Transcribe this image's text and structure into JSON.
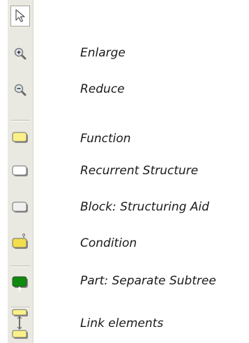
{
  "toolbar": {
    "tools": [
      {
        "icon": "pointer-arrow-icon",
        "label": ""
      },
      {
        "icon": "zoom-in-icon",
        "label": "Enlarge"
      },
      {
        "icon": "zoom-out-icon",
        "label": "Reduce"
      },
      {
        "icon": "function-node-icon",
        "label": "Function",
        "color": "#fbf08a"
      },
      {
        "icon": "recurrent-structure-node-icon",
        "label": "Recurrent Structure",
        "color": "#ffffff"
      },
      {
        "icon": "block-node-icon",
        "label": "Block: Structuring Aid",
        "color": "#f0f0f0"
      },
      {
        "icon": "condition-node-icon",
        "label": "Condition",
        "color": "#f2dd4c"
      },
      {
        "icon": "part-subtree-node-icon",
        "label": "Part: Separate Subtree",
        "color": "#0f8a0f"
      },
      {
        "icon": "link-elements-icon",
        "label": "Link elements"
      }
    ]
  }
}
